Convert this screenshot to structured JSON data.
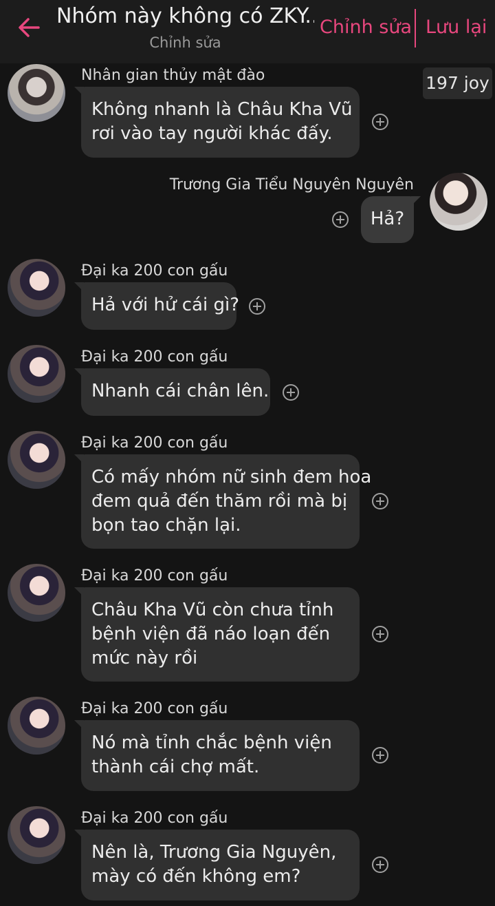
{
  "header": {
    "title": "Nhóm này không có ZKY...",
    "subtitle": "Chỉnh sửa",
    "edit_label": "Chỉnh sửa",
    "save_label": "Lưu lại",
    "accent_color": "#e8477e"
  },
  "joy_badge": "197 joy",
  "messages": [
    {
      "sender": "Nhân gian thủy mật đào",
      "lines": [
        "Không nhanh là Châu Kha Vũ",
        "rơi vào tay người khác đấy."
      ],
      "side": "left"
    },
    {
      "sender": "Trương Gia Tiểu Nguyên Nguyên",
      "lines": [
        "Hả?"
      ],
      "side": "right"
    },
    {
      "sender": "Đại ka 200 con gấu",
      "lines": [
        "Hả với hử cái gì?"
      ],
      "side": "left"
    },
    {
      "sender": "Đại ka 200 con gấu",
      "lines": [
        "Nhanh cái chân lên."
      ],
      "side": "left"
    },
    {
      "sender": "Đại ka 200 con gấu",
      "lines": [
        "Có mấy nhóm nữ sinh đem hoa",
        "đem quả đến thăm rồi mà bị",
        "bọn tao chặn lại."
      ],
      "side": "left"
    },
    {
      "sender": "Đại ka 200 con gấu",
      "lines": [
        "Châu Kha Vũ còn chưa tỉnh",
        "bệnh viện đã náo loạn đến",
        "mức này rồi"
      ],
      "side": "left"
    },
    {
      "sender": "Đại ka 200 con gấu",
      "lines": [
        "Nó mà tỉnh chắc bệnh viện",
        "thành cái chợ mất."
      ],
      "side": "left"
    },
    {
      "sender": "Đại ka 200 con gấu",
      "lines": [
        "Nên là, Trương Gia Nguyên,",
        "mày có đến không em?"
      ],
      "side": "left"
    }
  ],
  "icons": {
    "back": "arrow-left-icon",
    "react": "plus-circle-icon"
  }
}
